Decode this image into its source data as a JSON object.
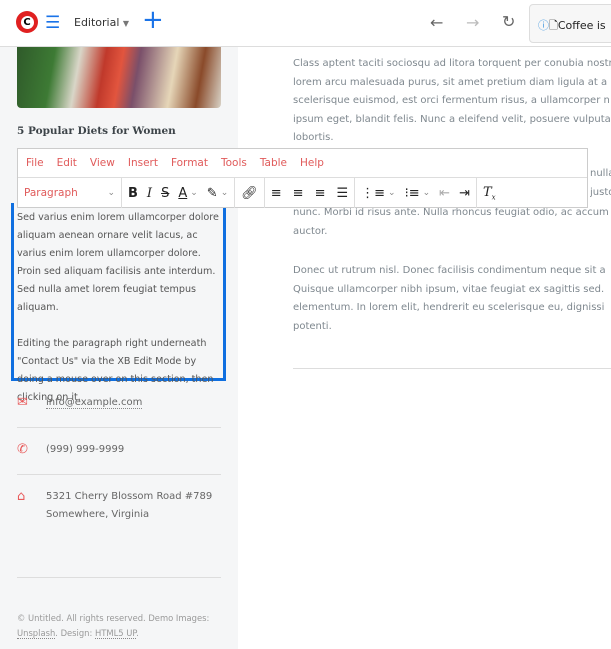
{
  "header": {
    "brand_letter": "C",
    "site_select": "Editorial",
    "url_text": "Coffee is "
  },
  "sidebar": {
    "article_title": "5 Popular Diets for Women",
    "paragraphs": [
      "Sed varius enim lorem ullamcorper dolore aliquam aenean ornare velit lacus, ac varius enim lorem ullamcorper dolore. Proin sed aliquam facilisis ante interdum. Sed nulla amet lorem feugiat tempus aliquam.",
      "Editing the paragraph right underneath \"Contact Us\" via the XB Edit Mode by doing a mouse over on this section, then clicking on it."
    ],
    "email": "info@example.com",
    "phone": "(999) 999-9999",
    "address_line1": "5321 Cherry Blossom Road #789",
    "address_line2": "Somewhere, Virginia",
    "footer_prefix": "© Untitled. All rights reserved. Demo Images: ",
    "footer_link1": "Unsplash",
    "footer_mid": ". Design: ",
    "footer_link2": "HTML5 UP",
    "footer_suffix": "."
  },
  "editor": {
    "menu": [
      "File",
      "Edit",
      "View",
      "Insert",
      "Format",
      "Tools",
      "Table",
      "Help"
    ],
    "block_format": "Paragraph"
  },
  "main": {
    "lines": [
      "Class aptent taciti sociosqu ad litora torquent per conubia nostra",
      "lorem arcu malesuada purus, sit amet pretium diam ligula at a",
      "scelerisque euismod, est orci fermentum risus, a ullamcorper n",
      "ipsum eget, blandit felis. Nunc a eleifend velit, posuere vulputa",
      "lobortis.",
      "nulla",
      "justo",
      "nunc. Morbi id risus ante. Nulla rhoncus feugiat odio, ac accum",
      "auctor.",
      "Donec ut rutrum nisl. Donec facilisis condimentum neque sit a",
      "Quisque ullamcorper nibh ipsum, vitae feugiat ex sagittis sed.",
      "elementum. In lorem elit, hendrerit eu scelerisque eu, dignissi",
      "potenti."
    ]
  },
  "colors": {
    "accent": "#0f6fe0",
    "brand": "#e02020",
    "icon": "#e85a5a"
  }
}
